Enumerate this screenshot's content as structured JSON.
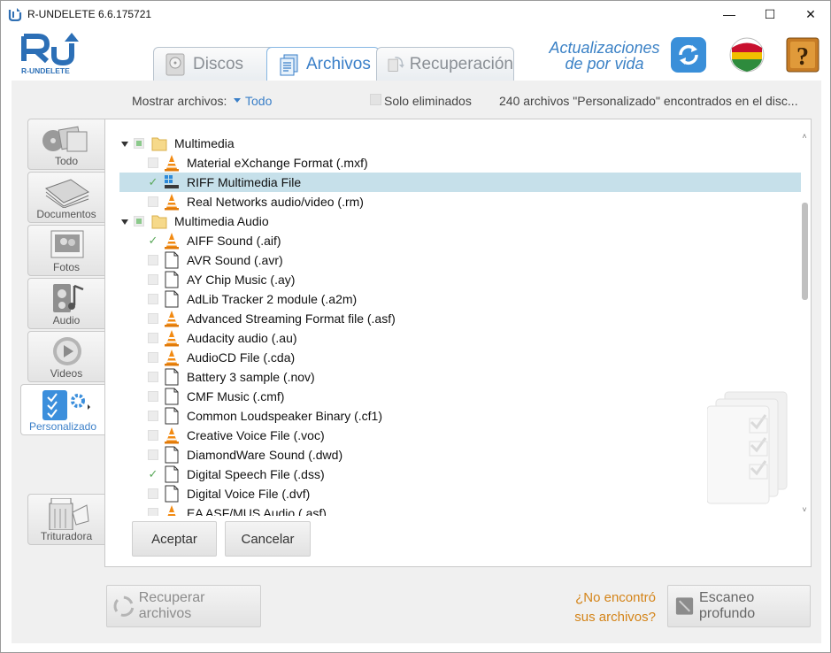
{
  "window": {
    "title": "R-UNDELETE 6.6.175721",
    "controls": {
      "minimize": "—",
      "maximize": "☐",
      "close": "✕"
    }
  },
  "header": {
    "logo_text": "R-UNDELETE",
    "tabs": [
      {
        "label": "Discos",
        "icon": "disk-icon",
        "active": false
      },
      {
        "label": "Archivos",
        "icon": "files-icon",
        "active": true
      },
      {
        "label": "Recuperación",
        "icon": "recovery-icon",
        "active": false
      }
    ],
    "promo_line1": "Actualizaciones",
    "promo_line2": "de por vida",
    "help_glyph": "?"
  },
  "filter": {
    "show_label": "Mostrar archivos:",
    "show_value": "Todo",
    "only_deleted_label": "Solo eliminados",
    "status": "240 archivos \"Personalizado\" encontrados en el disc..."
  },
  "sidebar": {
    "items": [
      {
        "label": "Todo",
        "icon": "all-files-icon",
        "active": false
      },
      {
        "label": "Documentos",
        "icon": "documents-icon",
        "active": false
      },
      {
        "label": "Fotos",
        "icon": "photos-icon",
        "active": false
      },
      {
        "label": "Audio",
        "icon": "audio-icon",
        "active": false
      },
      {
        "label": "Videos",
        "icon": "videos-icon",
        "active": false
      },
      {
        "label": "Personalizado",
        "icon": "custom-icon",
        "active": true
      },
      {
        "label": "Trituradora",
        "icon": "shredder-icon",
        "active": false
      }
    ]
  },
  "tree": {
    "rows": [
      {
        "label": "Multimedia",
        "kind": "folder",
        "check": "partial"
      },
      {
        "label": "Material eXchange Format (.mxf)",
        "kind": "vlc",
        "check": "off"
      },
      {
        "label": "RIFF Multimedia File",
        "kind": "riff",
        "check": "on",
        "selected": true
      },
      {
        "label": "Real Networks audio/video (.rm)",
        "kind": "vlc",
        "check": "off"
      },
      {
        "label": "Multimedia Audio",
        "kind": "folder",
        "check": "partial"
      },
      {
        "label": "AIFF Sound (.aif)",
        "kind": "vlc",
        "check": "on"
      },
      {
        "label": "AVR Sound (.avr)",
        "kind": "doc",
        "check": "off"
      },
      {
        "label": "AY Chip Music (.ay)",
        "kind": "doc",
        "check": "off"
      },
      {
        "label": "AdLib Tracker 2 module (.a2m)",
        "kind": "doc",
        "check": "off"
      },
      {
        "label": "Advanced Streaming Format file (.asf)",
        "kind": "vlc",
        "check": "off"
      },
      {
        "label": "Audacity audio (.au)",
        "kind": "vlc",
        "check": "off"
      },
      {
        "label": "AudioCD File (.cda)",
        "kind": "vlc",
        "check": "off"
      },
      {
        "label": "Battery 3 sample (.nov)",
        "kind": "doc",
        "check": "off"
      },
      {
        "label": "CMF Music (.cmf)",
        "kind": "doc",
        "check": "off"
      },
      {
        "label": "Common Loudspeaker Binary (.cf1)",
        "kind": "doc",
        "check": "off"
      },
      {
        "label": "Creative Voice File (.voc)",
        "kind": "vlc",
        "check": "off"
      },
      {
        "label": "DiamondWare Sound (.dwd)",
        "kind": "doc",
        "check": "off"
      },
      {
        "label": "Digital Speech File (.dss)",
        "kind": "doc",
        "check": "on"
      },
      {
        "label": "Digital Voice File (.dvf)",
        "kind": "doc",
        "check": "off"
      },
      {
        "label": "EA ASF/MUS Audio (.asf)",
        "kind": "vlc",
        "check": "off"
      }
    ]
  },
  "buttons": {
    "accept": "Aceptar",
    "cancel": "Cancelar",
    "recover": "Recuperar archivos",
    "deep_scan": "Escaneo profundo",
    "not_found_line1": "¿No encontró",
    "not_found_line2": "sus archivos?"
  },
  "colors": {
    "accent": "#3a7fc8",
    "selection": "#c6e0ea",
    "orange_link": "#d48419"
  }
}
